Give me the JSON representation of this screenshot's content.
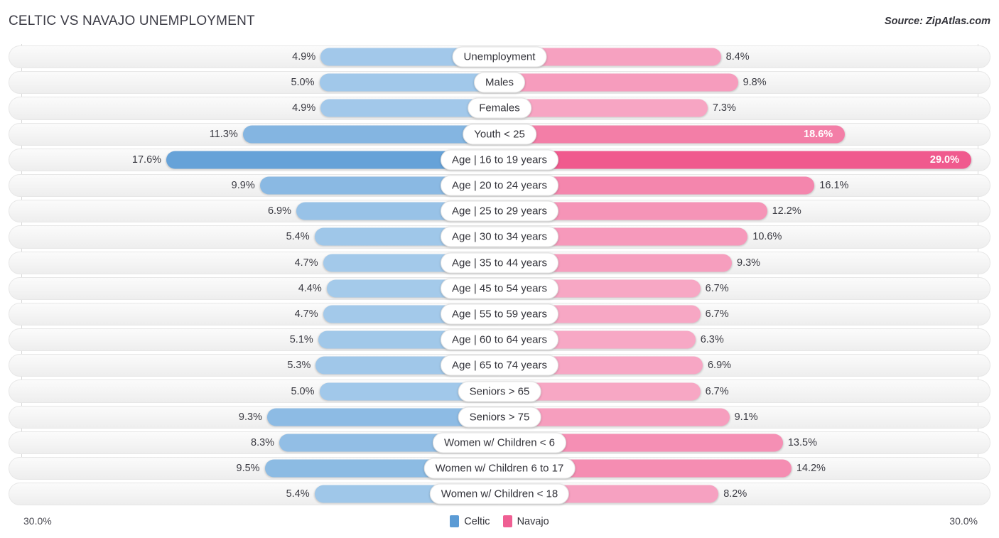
{
  "header": {
    "title": "CELTIC VS NAVAJO UNEMPLOYMENT",
    "source": "Source: ZipAtlas.com"
  },
  "axis": {
    "left_label": "30.0%",
    "right_label": "30.0%",
    "max": 30.0
  },
  "legend": {
    "items": [
      {
        "label": "Celtic",
        "color": "#5b9bd5"
      },
      {
        "label": "Navajo",
        "color": "#ef5f93"
      }
    ]
  },
  "colors": {
    "celtic_light": "#a6cbeb",
    "celtic_dark": "#5b9bd5",
    "navajo_light": "#f7a9c6",
    "navajo_dark": "#f05a8e",
    "track": "#f4f4f4",
    "text": "#33333a"
  },
  "chart_data": {
    "type": "bar",
    "orientation": "horizontal-diverging",
    "title": "CELTIC VS NAVAJO UNEMPLOYMENT",
    "xlabel": "",
    "ylabel": "",
    "xlim": [
      30.0,
      30.0
    ],
    "grid": false,
    "legend_position": "bottom-center",
    "series": [
      {
        "name": "Celtic",
        "side": "left",
        "color": "#5b9bd5",
        "values": [
          4.9,
          5.0,
          4.9,
          11.3,
          17.6,
          9.9,
          6.9,
          5.4,
          4.7,
          4.4,
          4.7,
          5.1,
          5.3,
          5.0,
          9.3,
          8.3,
          9.5,
          5.4
        ]
      },
      {
        "name": "Navajo",
        "side": "right",
        "color": "#ef5f93",
        "values": [
          8.4,
          9.8,
          7.3,
          18.6,
          29.0,
          16.1,
          12.2,
          10.6,
          9.3,
          6.7,
          6.7,
          6.3,
          6.9,
          6.7,
          9.1,
          13.5,
          14.2,
          8.2
        ]
      }
    ],
    "categories": [
      "Unemployment",
      "Males",
      "Females",
      "Youth < 25",
      "Age | 16 to 19 years",
      "Age | 20 to 24 years",
      "Age | 25 to 29 years",
      "Age | 30 to 34 years",
      "Age | 35 to 44 years",
      "Age | 45 to 54 years",
      "Age | 55 to 59 years",
      "Age | 60 to 64 years",
      "Age | 65 to 74 years",
      "Seniors > 65",
      "Seniors > 75",
      "Women w/ Children < 6",
      "Women w/ Children 6 to 17",
      "Women w/ Children < 18"
    ]
  },
  "rows": [
    {
      "label": "Unemployment",
      "left": "4.9%",
      "right": "8.4%",
      "lv": 4.9,
      "rv": 8.4
    },
    {
      "label": "Males",
      "left": "5.0%",
      "right": "9.8%",
      "lv": 5.0,
      "rv": 9.8
    },
    {
      "label": "Females",
      "left": "4.9%",
      "right": "7.3%",
      "lv": 4.9,
      "rv": 7.3
    },
    {
      "label": "Youth < 25",
      "left": "11.3%",
      "right": "18.6%",
      "lv": 11.3,
      "rv": 18.6
    },
    {
      "label": "Age | 16 to 19 years",
      "left": "17.6%",
      "right": "29.0%",
      "lv": 17.6,
      "rv": 29.0
    },
    {
      "label": "Age | 20 to 24 years",
      "left": "9.9%",
      "right": "16.1%",
      "lv": 9.9,
      "rv": 16.1
    },
    {
      "label": "Age | 25 to 29 years",
      "left": "6.9%",
      "right": "12.2%",
      "lv": 6.9,
      "rv": 12.2
    },
    {
      "label": "Age | 30 to 34 years",
      "left": "5.4%",
      "right": "10.6%",
      "lv": 5.4,
      "rv": 10.6
    },
    {
      "label": "Age | 35 to 44 years",
      "left": "4.7%",
      "right": "9.3%",
      "lv": 4.7,
      "rv": 9.3
    },
    {
      "label": "Age | 45 to 54 years",
      "left": "4.4%",
      "right": "6.7%",
      "lv": 4.4,
      "rv": 6.7
    },
    {
      "label": "Age | 55 to 59 years",
      "left": "4.7%",
      "right": "6.7%",
      "lv": 4.7,
      "rv": 6.7
    },
    {
      "label": "Age | 60 to 64 years",
      "left": "5.1%",
      "right": "6.3%",
      "lv": 5.1,
      "rv": 6.3
    },
    {
      "label": "Age | 65 to 74 years",
      "left": "5.3%",
      "right": "6.9%",
      "lv": 5.3,
      "rv": 6.9
    },
    {
      "label": "Seniors > 65",
      "left": "5.0%",
      "right": "6.7%",
      "lv": 5.0,
      "rv": 6.7
    },
    {
      "label": "Seniors > 75",
      "left": "9.3%",
      "right": "9.1%",
      "lv": 9.3,
      "rv": 9.1
    },
    {
      "label": "Women w/ Children < 6",
      "left": "8.3%",
      "right": "13.5%",
      "lv": 8.3,
      "rv": 13.5
    },
    {
      "label": "Women w/ Children 6 to 17",
      "left": "9.5%",
      "right": "14.2%",
      "lv": 9.5,
      "rv": 14.2
    },
    {
      "label": "Women w/ Children < 18",
      "left": "5.4%",
      "right": "8.2%",
      "lv": 5.4,
      "rv": 8.2
    }
  ]
}
